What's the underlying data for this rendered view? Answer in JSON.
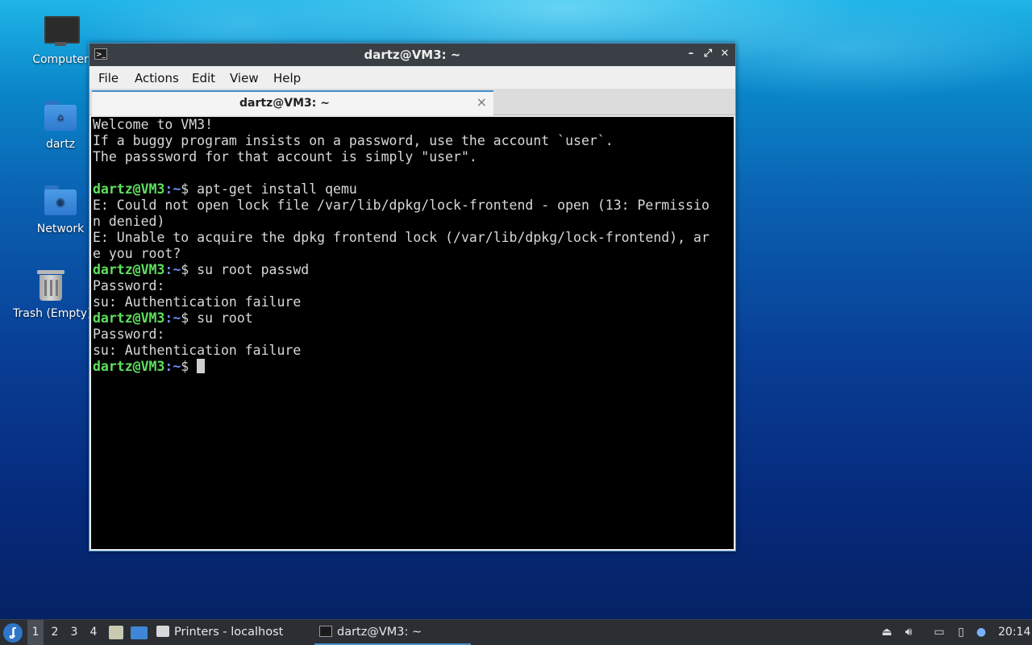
{
  "desktop": {
    "icons": [
      {
        "label": "Computer",
        "icon": "computer-icon"
      },
      {
        "label": "dartz",
        "icon": "home-folder-icon"
      },
      {
        "label": "Network",
        "icon": "network-folder-icon"
      },
      {
        "label": "Trash (Empty)",
        "icon": "trash-icon"
      }
    ]
  },
  "window": {
    "title": "dartz@VM3: ~",
    "menu": [
      "File",
      "Actions",
      "Edit",
      "View",
      "Help"
    ],
    "tab": {
      "label": "dartz@VM3: ~",
      "close": "×"
    },
    "controls": {
      "minimize": "–",
      "maximize": "⤢",
      "close": "✕"
    }
  },
  "terminal": {
    "user_host": "dartz@VM3",
    "path_sep": ":",
    "path": "~",
    "prompt_char": "$",
    "lines": [
      "Welcome to VM3!",
      "If a buggy program insists on a password, use the account `user`.",
      "The passsword for that account is simply \"user\".",
      "",
      "E: Could not open lock file /var/lib/dpkg/lock-frontend - open (13: Permissio",
      "n denied)",
      "E: Unable to acquire the dpkg frontend lock (/var/lib/dpkg/lock-frontend), ar",
      "e you root?",
      "Password:",
      "su: Authentication failure",
      "Password:",
      "su: Authentication failure"
    ],
    "commands": [
      "apt-get install qemu",
      "su root passwd",
      "su root"
    ]
  },
  "taskbar": {
    "workspaces": [
      "1",
      "2",
      "3",
      "4"
    ],
    "active_workspace": "1",
    "tasks": [
      {
        "label": "Printers - localhost",
        "icon": "printer-icon"
      },
      {
        "label": "dartz@VM3: ~",
        "icon": "terminal-icon"
      }
    ],
    "clock": "20:14"
  },
  "colors": {
    "prompt_user": "#5ee05e",
    "prompt_path": "#6a8cff",
    "terminal_bg": "#000000",
    "accent": "#4a90c8"
  }
}
